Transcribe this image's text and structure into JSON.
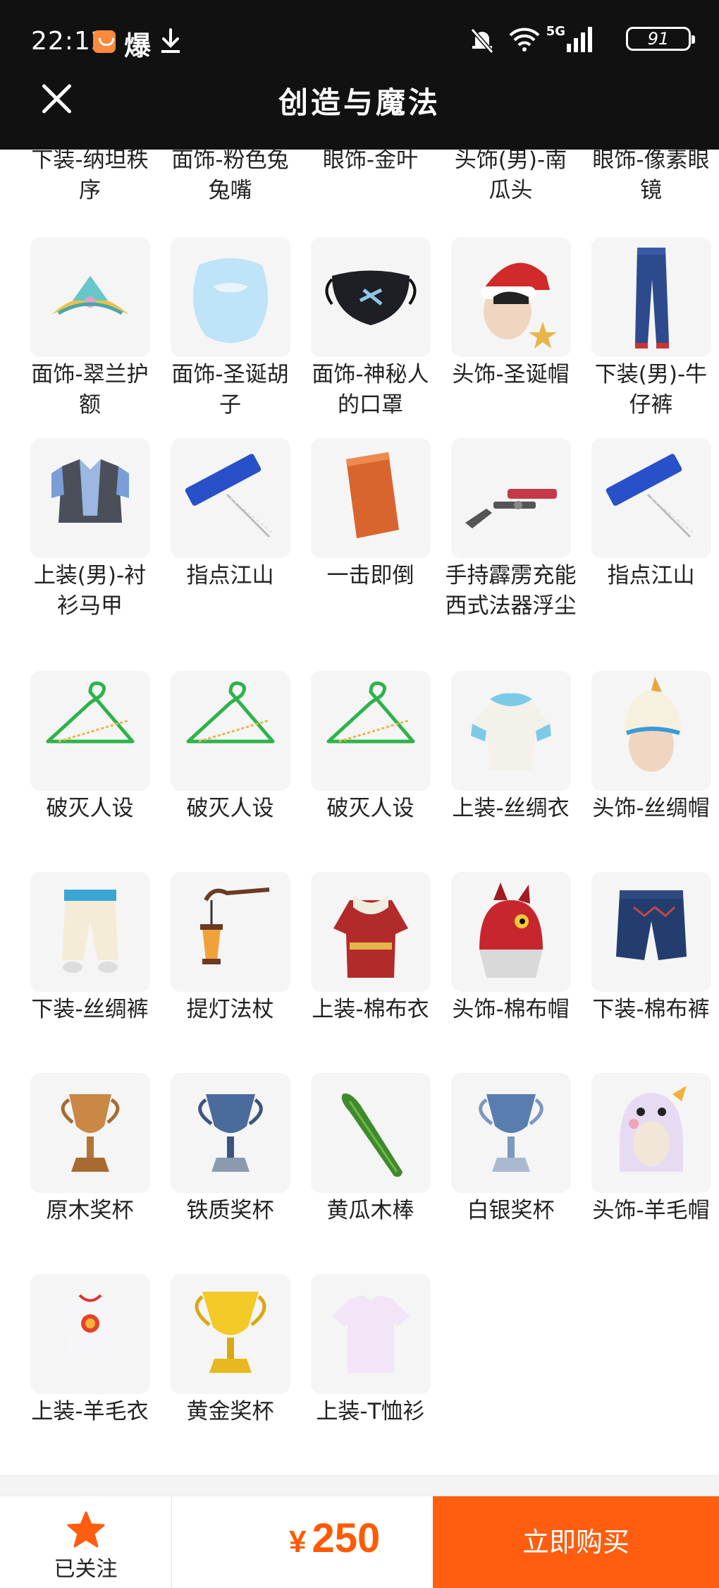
{
  "status_bar": {
    "time": "22:12",
    "app_glyph": "爆",
    "signal_label": "5G",
    "battery": "91"
  },
  "header": {
    "title": "创造与魔法"
  },
  "partial_row": [
    {
      "name": "下装-纳坦秩序"
    },
    {
      "name": "面饰-粉色兔兔嘴"
    },
    {
      "name": "眼饰-金叶"
    },
    {
      "name": "头饰(男)-南瓜头"
    },
    {
      "name": "眼饰-像素眼镜"
    }
  ],
  "rows": [
    [
      {
        "name": "面饰-翠兰护额",
        "icon": "headband-icon"
      },
      {
        "name": "面饰-圣诞胡子",
        "icon": "beard-icon"
      },
      {
        "name": "面饰-神秘人的口罩",
        "icon": "mask-icon"
      },
      {
        "name": "头饰-圣诞帽",
        "icon": "christmas-hat-icon"
      },
      {
        "name": "下装(男)-牛仔裤",
        "icon": "jeans-icon"
      }
    ],
    [
      {
        "name": "上装(男)-衬衫马甲",
        "icon": "vest-icon"
      },
      {
        "name": "指点江山",
        "icon": "sign-pointer-icon"
      },
      {
        "name": "一击即倒",
        "icon": "brick-icon"
      },
      {
        "name": "手持霹雳充能西式法器浮尘",
        "icon": "gun-icon"
      },
      {
        "name": "指点江山",
        "icon": "sign-pointer-icon"
      }
    ],
    [
      {
        "name": "破灭人设",
        "icon": "hanger-icon"
      },
      {
        "name": "破灭人设",
        "icon": "hanger-icon"
      },
      {
        "name": "破灭人设",
        "icon": "hanger-icon"
      },
      {
        "name": "上装-丝绸衣",
        "icon": "silk-top-icon"
      },
      {
        "name": "头饰-丝绸帽",
        "icon": "turban-icon"
      }
    ],
    [
      {
        "name": "下装-丝绸裤",
        "icon": "silk-pants-icon"
      },
      {
        "name": "提灯法杖",
        "icon": "lantern-staff-icon"
      },
      {
        "name": "上装-棉布衣",
        "icon": "cotton-coat-icon"
      },
      {
        "name": "头饰-棉布帽",
        "icon": "dragon-hat-icon"
      },
      {
        "name": "下装-棉布裤",
        "icon": "cotton-shorts-icon"
      }
    ],
    [
      {
        "name": "原木奖杯",
        "icon": "wood-trophy-icon"
      },
      {
        "name": "铁质奖杯",
        "icon": "iron-trophy-icon"
      },
      {
        "name": "黄瓜木棒",
        "icon": "cucumber-icon"
      },
      {
        "name": "白银奖杯",
        "icon": "silver-trophy-icon"
      },
      {
        "name": "头饰-羊毛帽",
        "icon": "sheep-hat-icon"
      }
    ],
    [
      {
        "name": "上装-羊毛衣",
        "icon": "wool-suit-icon"
      },
      {
        "name": "黄金奖杯",
        "icon": "gold-trophy-icon"
      },
      {
        "name": "上装-T恤衫",
        "icon": "tshirt-icon"
      }
    ]
  ],
  "bottom_bar": {
    "follow_label": "已关注",
    "currency": "¥",
    "price": "250",
    "buy_label": "立即购买"
  },
  "colors": {
    "accent": "#ff5d0f",
    "price": "#ff5a00",
    "header_bg": "#111111"
  }
}
